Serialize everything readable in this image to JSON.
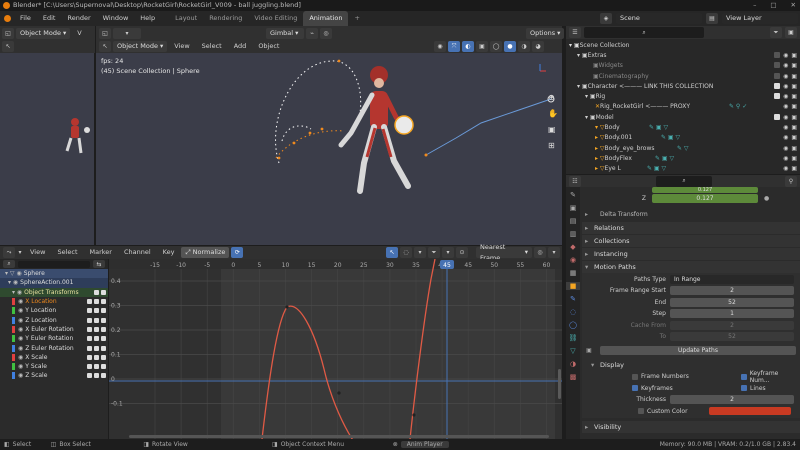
{
  "titlebar": {
    "title": "Blender* [C:\\Users\\Supernoval\\Desktop\\RocketGirl\\RocketGirl_V009 - ball juggling.blend]",
    "minimize": "–",
    "maximize": "□",
    "close": "✕"
  },
  "menubar": {
    "menus": [
      "File",
      "Edit",
      "Render",
      "Window",
      "Help"
    ],
    "workspaces": [
      {
        "label": "Layout",
        "active": false
      },
      {
        "label": "Rendering",
        "active": false
      },
      {
        "label": "Video Editing",
        "active": false
      },
      {
        "label": "Animation",
        "active": true
      }
    ],
    "add_workspace": "+",
    "scene": "Scene",
    "view_layer": "View Layer"
  },
  "left_header": {
    "mode": "Object Mode",
    "view": "V"
  },
  "viewport_header": {
    "mode": "Object Mode",
    "menus": [
      "View",
      "Select",
      "Add",
      "Object"
    ],
    "pivot": "Gimbal",
    "options": "Options"
  },
  "viewport": {
    "fps": "fps: 24",
    "info": "(45) Scene Collection | Sphere",
    "axes": {
      "x": "X",
      "y": "Y",
      "z": "Z"
    }
  },
  "outliner": {
    "items": [
      {
        "label": "Scene Collection",
        "indent": 0
      },
      {
        "label": "Extras",
        "indent": 1
      },
      {
        "label": "Widgets",
        "indent": 2
      },
      {
        "label": "Cinematography",
        "indent": 2
      },
      {
        "label": "Character <——— LINK THIS COLLECTION",
        "indent": 1
      },
      {
        "label": "Rig",
        "indent": 2
      },
      {
        "label": "Rig_RocketGirl <——— PROXY",
        "indent": 3
      },
      {
        "label": "Model",
        "indent": 2
      },
      {
        "label": "Body",
        "indent": 3
      },
      {
        "label": "Body.001",
        "indent": 3
      },
      {
        "label": "Body_eye_brows",
        "indent": 3
      },
      {
        "label": "BodyFlex",
        "indent": 3
      },
      {
        "label": "Eye L",
        "indent": 3
      }
    ]
  },
  "properties": {
    "z_label": "Z",
    "z_value": "0.127",
    "z_prev_value": "0.127",
    "sections": [
      "Delta Transform",
      "Relations",
      "Collections",
      "Instancing"
    ],
    "motion_paths": {
      "title": "Motion Paths",
      "paths_type_label": "Paths Type",
      "paths_type_value": "In Range",
      "frame_range_start_label": "Frame Range Start",
      "frame_range_start": "2",
      "end_label": "End",
      "end": "52",
      "step_label": "Step",
      "step": "1",
      "cache_from_label": "Cache From",
      "cache_from": "2",
      "to_label": "To",
      "to": "52",
      "update_paths": "Update Paths",
      "display_title": "Display",
      "frame_numbers": "Frame Numbers",
      "keyframe_numbers": "Keyframe Num...",
      "keyframes": "Keyframes",
      "lines": "Lines",
      "thickness_label": "Thickness",
      "thickness": "2",
      "custom_color": "Custom Color",
      "custom_color_hex": "#c83a22"
    },
    "visibility": "Visibility"
  },
  "graph_header": {
    "menus": [
      "View",
      "Select",
      "Marker",
      "Channel",
      "Key"
    ],
    "normalize": "Normalize",
    "interp": "Nearest Frame"
  },
  "channels": {
    "items": [
      {
        "label": "Sphere",
        "color": "#5c8be0",
        "level": 0
      },
      {
        "label": "SphereAction.001",
        "color": "#5c8be0",
        "level": 1
      },
      {
        "label": "Object Transforms",
        "color": "#4aa04a",
        "level": 2
      },
      {
        "label": "X Location",
        "color": "#e04040",
        "level": 3
      },
      {
        "label": "Y Location",
        "color": "#40c040",
        "level": 3
      },
      {
        "label": "Z Location",
        "color": "#4080e0",
        "level": 3
      },
      {
        "label": "X Euler Rotation",
        "color": "#e04040",
        "level": 3
      },
      {
        "label": "Y Euler Rotation",
        "color": "#40c040",
        "level": 3
      },
      {
        "label": "Z Euler Rotation",
        "color": "#4080e0",
        "level": 3
      },
      {
        "label": "X Scale",
        "color": "#e04040",
        "level": 3
      },
      {
        "label": "Y Scale",
        "color": "#40c040",
        "level": 3
      },
      {
        "label": "Z Scale",
        "color": "#4080e0",
        "level": 3
      }
    ]
  },
  "graph": {
    "frame_ticks": [
      "-15",
      "-10",
      "-5",
      "0",
      "5",
      "10",
      "15",
      "20",
      "25",
      "30",
      "35",
      "40",
      "45",
      "50",
      "55",
      "60",
      "65"
    ],
    "current_frame": "45",
    "value_ticks": [
      "0.4",
      "0.3",
      "0.2",
      "0.1",
      "0",
      "-0.1"
    ]
  },
  "statusbar": {
    "items": [
      "Select",
      "Box Select",
      "Rotate View",
      "Object Context Menu",
      "Anim Player"
    ],
    "memory": "Memory: 90.0 MB | VRAM: 0.2/1.0 GB | 2.83.4"
  },
  "colors": {
    "accent": "#4772b3",
    "active_orange": "#f5a623",
    "curve": "#e05a45",
    "path_white": "#ffffff",
    "path_orange": "#f08a1e"
  }
}
